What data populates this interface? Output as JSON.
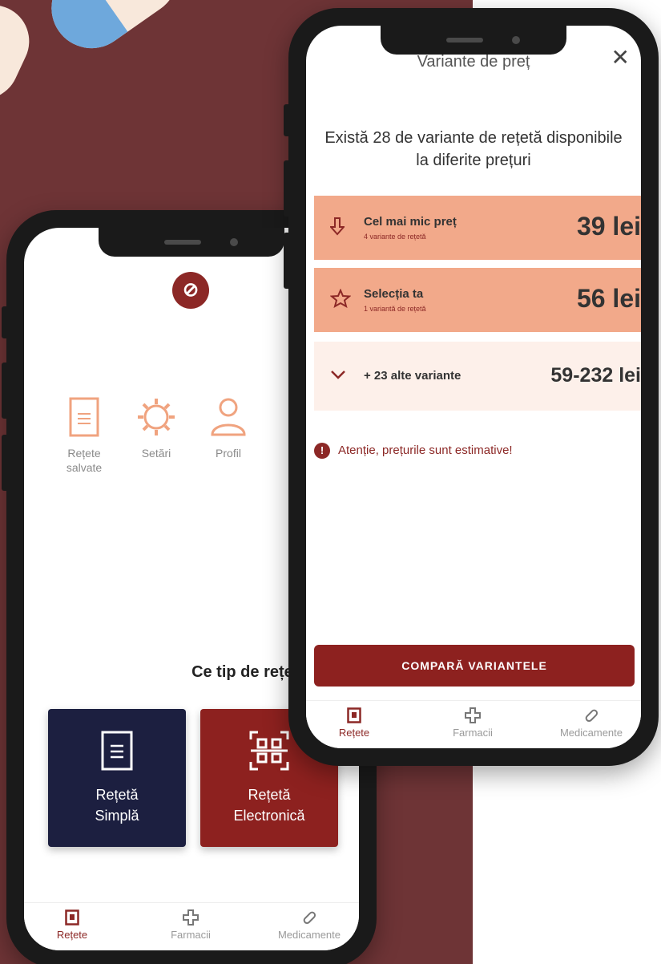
{
  "left_phone": {
    "quick_actions": [
      {
        "label": "Rețete\nsalvate",
        "icon": "document-icon"
      },
      {
        "label": "Setări",
        "icon": "gear-icon"
      },
      {
        "label": "Profil",
        "icon": "user-icon"
      }
    ],
    "question": "Ce tip de rețetă ai?",
    "cards": [
      {
        "label": "Rețetă\nSimplă",
        "icon": "document-icon",
        "color": "#1c1f40"
      },
      {
        "label": "Rețetă\nElectronică",
        "icon": "qr-code-icon",
        "color": "#8d211f"
      }
    ]
  },
  "right_phone": {
    "title": "Variante de preț",
    "headline": "Există 28 de variante de rețetă disponibile la diferite prețuri",
    "rows": [
      {
        "title": "Cel mai mic preț",
        "subtitle": "4 variante de rețetă",
        "price": "39 lei",
        "icon": "arrow-down-icon"
      },
      {
        "title": "Selecția ta",
        "subtitle": "1 variantă de rețetă",
        "price": "56 lei",
        "icon": "star-icon"
      },
      {
        "title": "+ 23 alte variante",
        "price": "59-232 lei",
        "icon": "chevron-down-icon"
      }
    ],
    "warning": "Atenție, prețurile sunt estimative!",
    "compare_button": "COMPARĂ VARIANTELE"
  },
  "tabbar": {
    "items": [
      {
        "label": "Rețete",
        "icon": "prescription-icon",
        "active": true
      },
      {
        "label": "Farmacii",
        "icon": "cross-icon",
        "active": false
      },
      {
        "label": "Medicamente",
        "icon": "pill-icon",
        "active": false
      }
    ]
  },
  "colors": {
    "brand": "#8c2826",
    "navy": "#1c1f40",
    "highlight": "#f2a98a",
    "background": "#6e3436",
    "icon_accent": "#f0a37f"
  }
}
